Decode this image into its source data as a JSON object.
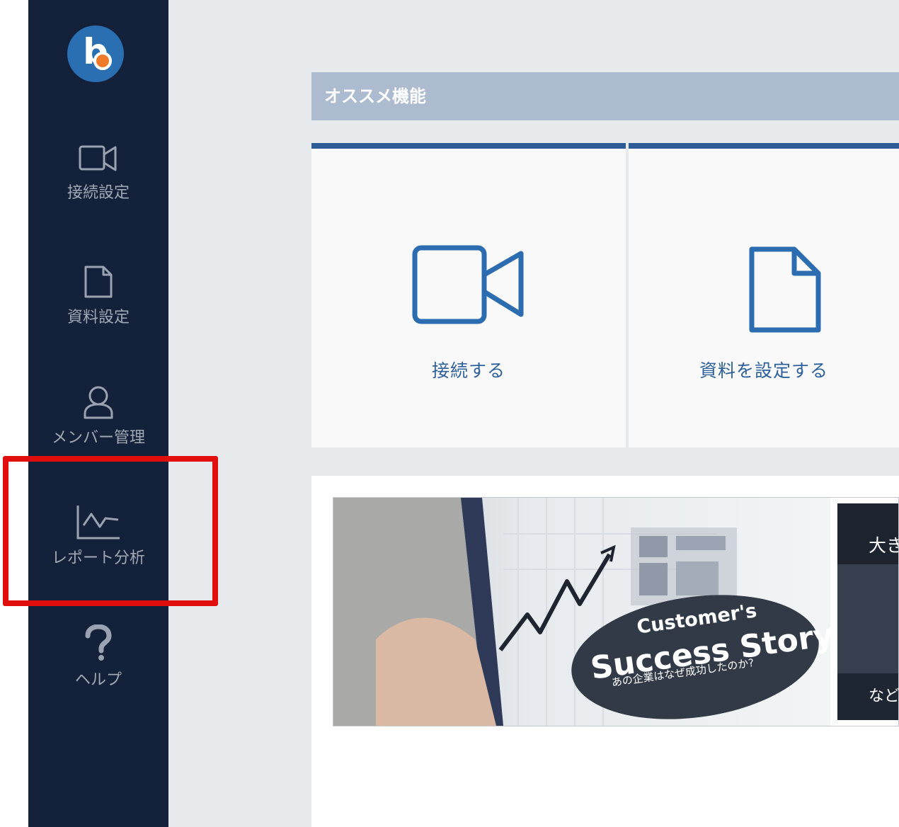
{
  "sidebar": {
    "logo_letter": "b",
    "items": [
      {
        "label": "接続設定",
        "icon": "video-camera-icon"
      },
      {
        "label": "資料設定",
        "icon": "document-icon"
      },
      {
        "label": "メンバー管理",
        "icon": "user-icon"
      },
      {
        "label": "レポート分析",
        "icon": "chart-line-icon"
      },
      {
        "label": "ヘルプ",
        "icon": "question-mark-icon"
      }
    ]
  },
  "main": {
    "section_title": "オススメ機能",
    "cards": [
      {
        "label": "接続する",
        "icon": "video-camera-icon"
      },
      {
        "label": "資料を設定する",
        "icon": "document-icon"
      }
    ],
    "banner": {
      "line1": "Customer's",
      "line2": "Success Story",
      "line3": "あの企業はなぜ成功したのか?",
      "side_top": "大き",
      "side_bottom": "など"
    }
  },
  "annotation": {
    "highlight_color": "#e10e0e",
    "highlight_target": "レポート分析"
  },
  "colors": {
    "sidebar_bg": "#14213b",
    "accent_blue": "#2c5b96",
    "header_bg": "#acbbd0",
    "logo_blue": "#2a6fb2",
    "logo_orange": "#ef7b2a"
  }
}
